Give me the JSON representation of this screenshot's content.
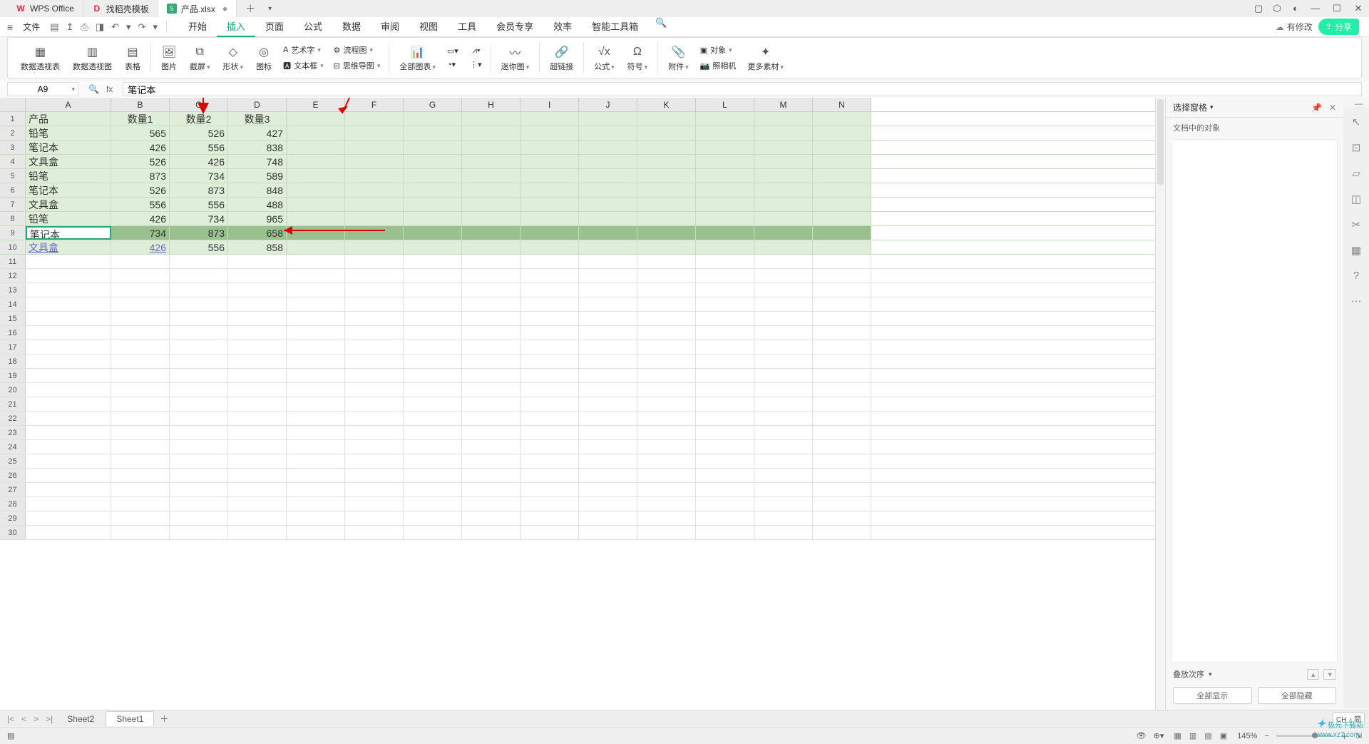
{
  "titlebar": {
    "tabs": [
      {
        "icon": "W",
        "icon_color": "red",
        "label": "WPS Office"
      },
      {
        "icon": "D",
        "icon_color": "red",
        "label": "找稻壳模板"
      },
      {
        "icon": "S",
        "icon_color": "green",
        "label": "产品.xlsx",
        "active": true,
        "modified": "●"
      }
    ],
    "plus": "＋"
  },
  "menubar": {
    "file": "文件",
    "tabs": [
      "开始",
      "插入",
      "页面",
      "公式",
      "数据",
      "审阅",
      "视图",
      "工具",
      "会员专享",
      "效率",
      "智能工具箱"
    ],
    "active_tab": "插入",
    "modify": "有修改",
    "share": "分享"
  },
  "ribbon": {
    "items": [
      {
        "label": "数据透视表"
      },
      {
        "label": "数据透视图"
      },
      {
        "label": "表格"
      },
      {
        "label": "图片"
      },
      {
        "label": "截屏",
        "drop": true
      },
      {
        "label": "形状",
        "drop": true
      },
      {
        "label": "图标"
      },
      {
        "label": "全部图表",
        "drop": true
      },
      {
        "label": "迷你图",
        "drop": true
      },
      {
        "label": "超链接"
      },
      {
        "label": "公式",
        "drop": true
      },
      {
        "label": "符号",
        "drop": true
      },
      {
        "label": "附件",
        "drop": true
      },
      {
        "label": "照相机"
      },
      {
        "label": "更多素材",
        "drop": true
      }
    ],
    "art": "艺术字",
    "flow": "流程图",
    "textbox": "文本框",
    "mind": "思维导图",
    "obj": "对象"
  },
  "fbar": {
    "name": "A9",
    "content": "笔记本"
  },
  "cols": [
    "A",
    "B",
    "C",
    "D",
    "E",
    "F",
    "G",
    "H",
    "I",
    "J",
    "K",
    "L",
    "M",
    "N"
  ],
  "table": {
    "headers": [
      "产品",
      "数量1",
      "数量2",
      "数量3"
    ],
    "rows": [
      [
        "铅笔",
        "565",
        "526",
        "427"
      ],
      [
        "笔记本",
        "426",
        "556",
        "838"
      ],
      [
        "文具盒",
        "526",
        "426",
        "748"
      ],
      [
        "铅笔",
        "873",
        "734",
        "589"
      ],
      [
        "笔记本",
        "526",
        "873",
        "848"
      ],
      [
        "文具盒",
        "556",
        "556",
        "488"
      ],
      [
        "铅笔",
        "426",
        "734",
        "965"
      ],
      [
        "笔记本",
        "734",
        "873",
        "658"
      ],
      [
        "文具盒",
        "426",
        "556",
        "858"
      ]
    ],
    "selected_row": 8
  },
  "sheets": {
    "tabs": [
      "Sheet2",
      "Sheet1"
    ],
    "active": "Sheet1"
  },
  "panel": {
    "title": "选择窗格",
    "sub": "文档中的对象",
    "order": "叠放次序",
    "show_all": "全部显示",
    "hide_all": "全部隐藏"
  },
  "status": {
    "ime": "CH ♪ 简",
    "zoom": "145%"
  },
  "watermark": {
    "name": "极光下载站",
    "url": "www.xz7.com"
  }
}
